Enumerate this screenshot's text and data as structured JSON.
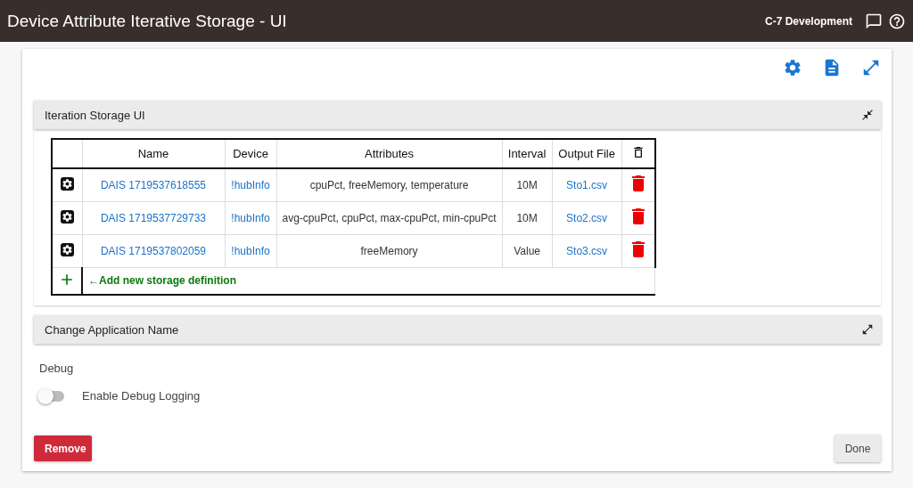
{
  "header": {
    "title": "Device Attribute Iterative Storage - UI",
    "hub_name": "C-7 Development"
  },
  "sections": [
    {
      "title": "Iteration Storage UI",
      "expanded": true
    },
    {
      "title": "Change Application Name",
      "expanded": false
    }
  ],
  "table": {
    "columns": [
      "Name",
      "Device",
      "Attributes",
      "Interval",
      "Output File"
    ],
    "rows": [
      {
        "name": "DAIS 1719537618555",
        "device": "!hubInfo",
        "attributes": "cpuPct, freeMemory, temperature",
        "interval": "10M",
        "output_file": "Sto1.csv"
      },
      {
        "name": "DAIS 1719537729733",
        "device": "!hubInfo",
        "attributes": "avg-cpuPct, cpuPct, max-cpuPct, min-cpuPct",
        "interval": "10M",
        "output_file": "Sto2.csv"
      },
      {
        "name": "DAIS 1719537802059",
        "device": "!hubInfo",
        "attributes": "freeMemory",
        "interval": "Value",
        "output_file": "Sto3.csv"
      }
    ],
    "add_label": "←Add new storage definition"
  },
  "debug": {
    "heading": "Debug",
    "toggle_label": "Enable Debug Logging",
    "on": false
  },
  "buttons": {
    "remove": "Remove",
    "done": "Done"
  }
}
